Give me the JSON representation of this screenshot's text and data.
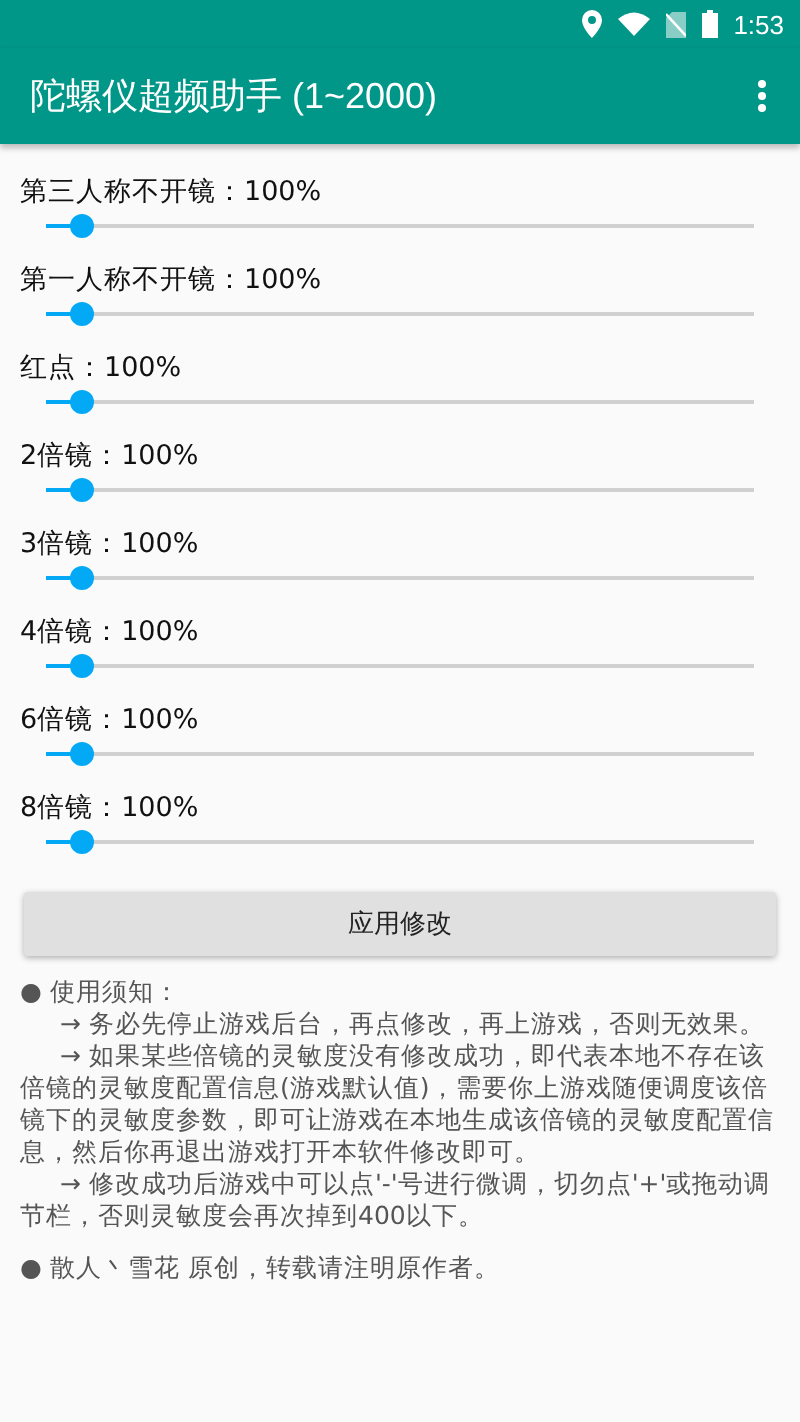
{
  "status_bar": {
    "time": "1:53"
  },
  "app_bar": {
    "title": "陀螺仪超频助手 (1~2000)"
  },
  "sliders": [
    {
      "label": "第三人称不开镜：100%",
      "level": 0.05
    },
    {
      "label": "第一人称不开镜：100%",
      "level": 0.05
    },
    {
      "label": "红点：100%",
      "level": 0.05
    },
    {
      "label": "2倍镜：100%",
      "level": 0.05
    },
    {
      "label": "3倍镜：100%",
      "level": 0.05
    },
    {
      "label": "4倍镜：100%",
      "level": 0.05
    },
    {
      "label": "6倍镜：100%",
      "level": 0.05
    },
    {
      "label": "8倍镜：100%",
      "level": 0.05
    }
  ],
  "apply_button": "应用修改",
  "notes": [
    {
      "kind": "heading",
      "text": "● 使用须知："
    },
    {
      "kind": "item",
      "text": "→ 务必先停止游戏后台，再点修改，再上游戏，否则无效果。"
    },
    {
      "kind": "item",
      "text": "→ 如果某些倍镜的灵敏度没有修改成功，即代表本地不存在该倍镜的灵敏度配置信息(游戏默认值)，需要你上游戏随便调度该倍镜下的灵敏度参数，即可让游戏在本地生成该倍镜的灵敏度配置信息，然后你再退出游戏打开本软件修改即可。"
    },
    {
      "kind": "item",
      "text": "→ 修改成功后游戏中可以点'-'号进行微调，切勿点'+'或拖动调节栏，否则灵敏度会再次掉到400以下。"
    },
    {
      "kind": "footer",
      "text": "● 散人丶雪花 原创，转载请注明原作者。"
    }
  ]
}
